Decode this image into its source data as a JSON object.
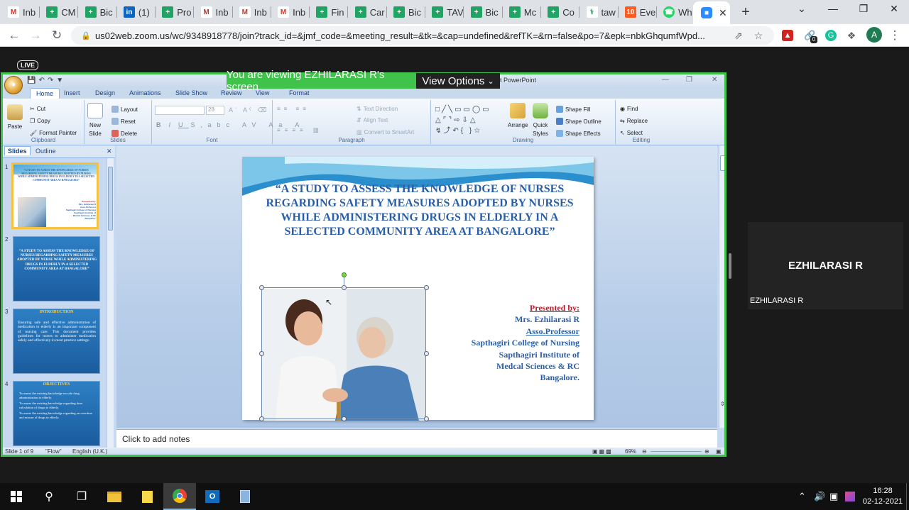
{
  "browser": {
    "tabs": [
      {
        "icon": "gmail-icon",
        "title": "Inb",
        "color": "#ffffff"
      },
      {
        "icon": "sheets-icon",
        "title": "CM",
        "color": "#1fa463"
      },
      {
        "icon": "sheets-icon",
        "title": "Bic",
        "color": "#1fa463"
      },
      {
        "icon": "linkedin-icon",
        "title": "(1)",
        "color": "#0a66c2"
      },
      {
        "icon": "sheets-icon",
        "title": "Pro",
        "color": "#1fa463"
      },
      {
        "icon": "gmail-icon",
        "title": "Inb",
        "color": "#ffffff"
      },
      {
        "icon": "gmail-icon",
        "title": "Inb",
        "color": "#ffffff"
      },
      {
        "icon": "gmail-icon",
        "title": "Inb",
        "color": "#ffffff"
      },
      {
        "icon": "sheets-icon",
        "title": "Fin",
        "color": "#1fa463"
      },
      {
        "icon": "sheets-icon",
        "title": "Car",
        "color": "#1fa463"
      },
      {
        "icon": "sheets-icon",
        "title": "Bic",
        "color": "#1fa463"
      },
      {
        "icon": "sheets-icon",
        "title": "TAV",
        "color": "#1fa463"
      },
      {
        "icon": "sheets-icon",
        "title": "Bic",
        "color": "#1fa463"
      },
      {
        "icon": "sheets-icon",
        "title": "Mc",
        "color": "#1fa463"
      },
      {
        "icon": "sheets-icon",
        "title": "Co",
        "color": "#1fa463"
      },
      {
        "icon": "tool-icon",
        "title": "taw",
        "color": "#ffffff"
      },
      {
        "icon": "ten-icon",
        "title": "Eve",
        "color": "#ff5a1f"
      },
      {
        "icon": "whatsapp-icon",
        "title": "Wh",
        "color": "#25d366"
      }
    ],
    "active_tab_icon": "zoom-icon",
    "url": "us02web.zoom.us/wc/9348918778/join?track_id=&jmf_code=&meeting_result=&tk=&cap=undefined&refTK=&rn=false&po=7&epk=nbkGhqumfWpd...",
    "profile_initial": "A",
    "extension_badge": "0"
  },
  "zoom": {
    "live_label": "LIVE",
    "viewing_banner": "You are viewing EZHILARASI R's screen",
    "view_options": "View Options",
    "participant_name": "EZHILARASI R",
    "participant_label": "EZHILARASI R",
    "accent_color": "#3fc34a"
  },
  "ppt": {
    "title_fragment": "t PowerPoint",
    "ribbon_tabs": [
      "Home",
      "Insert",
      "Design",
      "Animations",
      "Slide Show",
      "Review",
      "View",
      "Format"
    ],
    "groups": {
      "clipboard": {
        "label": "Clipboard",
        "paste": "Paste",
        "cut": "Cut",
        "copy": "Copy",
        "format_painter": "Format Painter"
      },
      "slides": {
        "label": "Slides",
        "new_slide_1": "New",
        "new_slide_2": "Slide",
        "layout": "Layout",
        "reset": "Reset",
        "delete": "Delete"
      },
      "font": {
        "label": "Font",
        "size": "28"
      },
      "paragraph": {
        "label": "Paragraph",
        "text_direction": "Text Direction",
        "align_text": "Align Text",
        "smartart": "Convert to SmartArt"
      },
      "drawing": {
        "label": "Drawing",
        "arrange": "Arrange",
        "quick_styles_1": "Quick",
        "quick_styles_2": "Styles",
        "shape_fill": "Shape Fill",
        "shape_outline": "Shape Outline",
        "shape_effects": "Shape Effects"
      },
      "editing": {
        "label": "Editing",
        "find": "Find",
        "replace": "Replace",
        "select": "Select"
      }
    },
    "pane_tabs": [
      "Slides",
      "Outline"
    ],
    "thumbnails": [
      {
        "num": "1",
        "text": "“A STUDY TO ASSESS THE KNOWLEDGE OF NURSES REGARDING SAFETY MEASURES ADOPTED BY NURSES WHILE ADMINISTERING DRUGS IN ELDERLY IN A SELECTED COMMUNITY AREA AT BANGALORE”"
      },
      {
        "num": "2",
        "text": "“A STUDY TO ASSESS THE KNOWLEDGE OF NURSES REGARDING SAFETY MEASURES ADOPTED BY NURSE WHILE ADMINISTERING DRUGS IN ELDERLY IN A SELECTED COMMUNITY AREA AT BANGALORE”"
      },
      {
        "num": "3",
        "heading": "INTRODUCTION",
        "text": "Ensuring safe and effective administration of medication to elderly is an important component of nursing care. This document provides guidelines for nurses to administer medication safely and effectively in most practice settings."
      },
      {
        "num": "4",
        "heading": "OBJECTIVES",
        "items": [
          "To assess the existing knowledge on safe drug administration to elderly.",
          "To assess the existing knowledge regarding dose calculation of drugs to elderly.",
          "To assess the existing knowledge regarding on overdose and misuse of drugs in elderly."
        ]
      }
    ],
    "slide": {
      "title": "“A STUDY TO ASSESS THE KNOWLEDGE OF NURSES REGARDING SAFETY MEASURES ADOPTED BY NURSES WHILE  ADMINISTERING DRUGS IN ELDERLY IN A SELECTED COMMUNITY AREA AT  BANGALORE”",
      "presented_by": "Presented by:",
      "presenter_lines": [
        "Mrs. Ezhilarasi R",
        "Asso.Professor",
        "Sapthagiri College of Nursing",
        "Sapthagiri  Institute of",
        "Medcal Sciences  & RC",
        "Bangalore."
      ]
    },
    "notes_placeholder": "Click to add notes",
    "status": {
      "slide_of": "Slide 1 of 9",
      "theme": "\"Flow\"",
      "language": "English (U.K.)",
      "zoom": "69%"
    }
  },
  "taskbar": {
    "time": "16:28",
    "date": "02-12-2021"
  }
}
